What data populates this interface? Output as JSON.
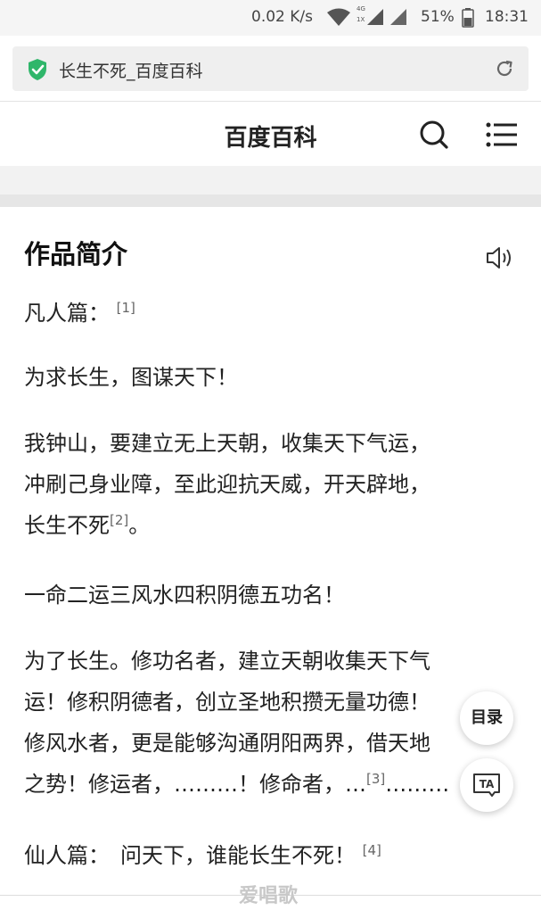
{
  "status_bar": {
    "net_speed": "0.02 K/s",
    "net_type_top": "4G",
    "net_type_bottom": "1X",
    "battery": "51%",
    "time": "18:31"
  },
  "url_bar": {
    "title": "长生不死_百度百科",
    "secure_icon": "shield-check-icon",
    "reload_icon": "reload-icon"
  },
  "nav": {
    "brand": "百度百科",
    "search_icon": "search-icon",
    "menu_icon": "menu-icon"
  },
  "article": {
    "section_title": "作品简介",
    "paragraphs": [
      {
        "text": "凡人篇：",
        "ref": "[1]"
      },
      {
        "text": "为求长生，图谋天下！"
      },
      {
        "lines": [
          "我钟山，要建立无上天朝，收集天下气运，",
          "冲刷己身业障，至此迎抗天威，开天辟地，"
        ],
        "last_text": "长生不死",
        "ref": "[2]",
        "tail": "。"
      },
      {
        "text": "一命二运三风水四积阴德五功名！"
      },
      {
        "lines": [
          "为了长生。修功名者，建立天朝收集天下气",
          "运！修积阴德者，创立圣地积攒无量功德！",
          "修风水者，更是能够沟通阴阳两界，借天地"
        ],
        "last_text": "之势！修运者，………！修命者，…",
        "ref": "[3]",
        "tail": "………"
      },
      {
        "text": "仙人篇：　问天下，谁能长生不死！",
        "ref": "[4]"
      }
    ]
  },
  "floating": {
    "toc_label": "目录",
    "ta_label": "TA"
  },
  "watermark": "爱唱歌"
}
